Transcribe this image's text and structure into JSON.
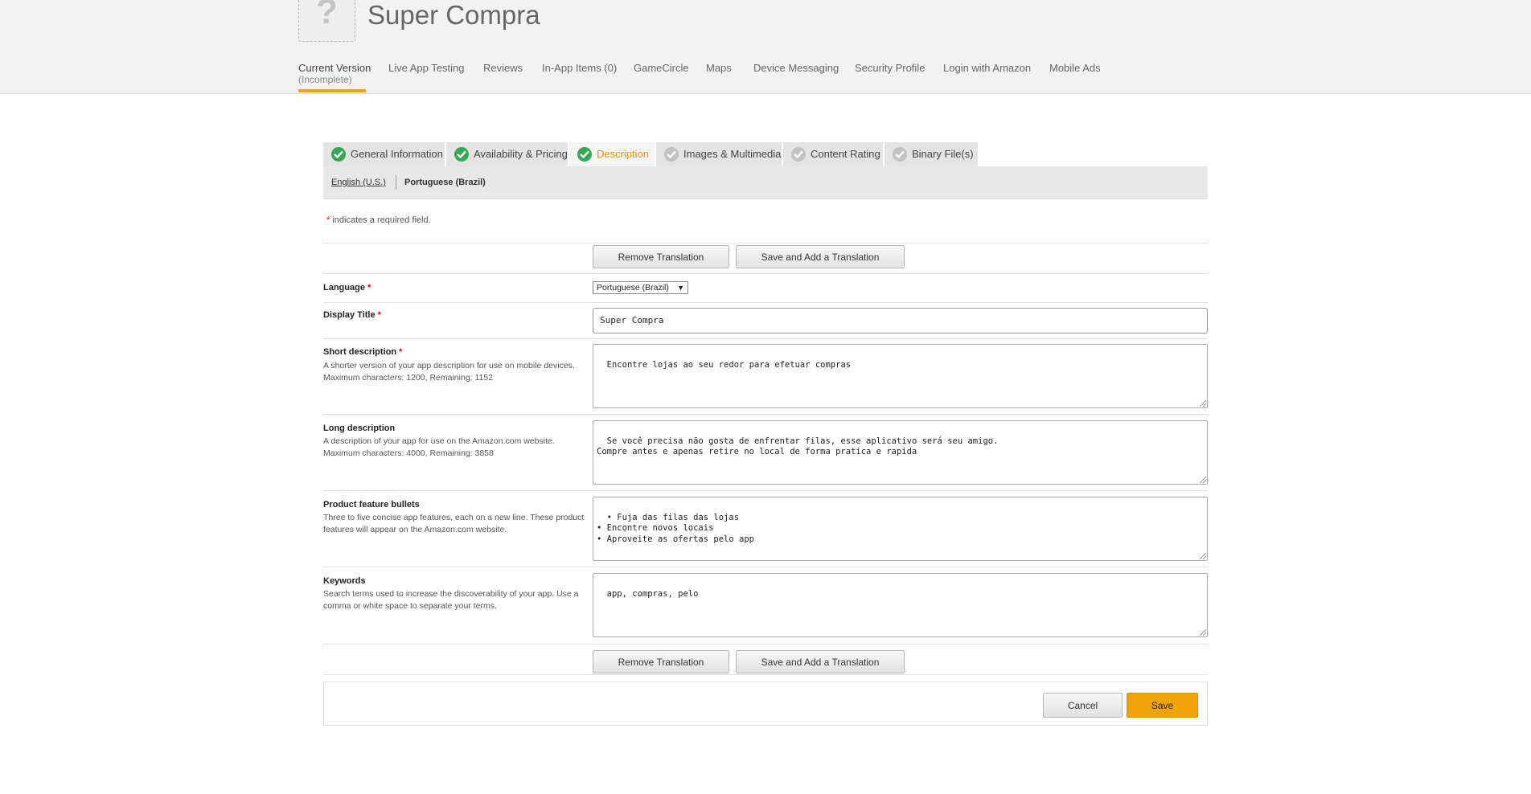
{
  "app": {
    "title": "Super Compra",
    "icon": "question-mark-placeholder-icon"
  },
  "main_tabs": [
    {
      "label": "Current Version",
      "sub": "(Incomplete)",
      "active": true
    },
    {
      "label": "Live App Testing"
    },
    {
      "label": "Reviews"
    },
    {
      "label": "In-App Items (0)"
    },
    {
      "label": "GameCircle"
    },
    {
      "label": "Maps"
    },
    {
      "label": "Device Messaging"
    },
    {
      "label": "Security Profile"
    },
    {
      "label": "Login with Amazon"
    },
    {
      "label": "Mobile Ads"
    }
  ],
  "section_tabs": [
    {
      "label": "General Information",
      "status": "complete"
    },
    {
      "label": "Availability & Pricing",
      "status": "complete"
    },
    {
      "label": "Description",
      "status": "complete",
      "active": true
    },
    {
      "label": "Images & Multimedia",
      "status": "incomplete"
    },
    {
      "label": "Content Rating",
      "status": "incomplete"
    },
    {
      "label": "Binary File(s)",
      "status": "incomplete"
    }
  ],
  "languages": {
    "english": "English (U.S.)",
    "portuguese": "Portuguese (Brazil)"
  },
  "required_note": {
    "star": "*",
    "text": " indicates a required field."
  },
  "buttons": {
    "remove_translation": "Remove Translation",
    "save_add_translation": "Save and Add a Translation",
    "cancel": "Cancel",
    "save": "Save"
  },
  "form": {
    "language": {
      "label": "Language",
      "value": "Portuguese (Brazil)"
    },
    "display_title": {
      "label": "Display Title",
      "value": "Super Compra"
    },
    "short_description": {
      "label": "Short description",
      "help1": "A shorter version of your app description for use on mobile devices.",
      "help2": "Maximum characters: 1200, Remaining: 1152",
      "value": "Encontre lojas ao seu redor para efetuar compras"
    },
    "long_description": {
      "label": "Long description",
      "help1": "A description of your app for use on the Amazon.com website.",
      "help2": "Maximum characters: 4000, Remaining: 3858",
      "value": "Se você precisa não gosta de enfrentar filas, esse aplicativo será seu amigo.\nCompre antes e apenas retire no local de forma pratica e rapida"
    },
    "feature_bullets": {
      "label": "Product feature bullets",
      "help1": "Three to five concise app features, each on a new line. These product features will appear on the Amazon.com website.",
      "value": "• Fuja das filas das lojas\n• Encontre novos locais\n• Aproveite as ofertas pelo app"
    },
    "keywords": {
      "label": "Keywords",
      "help1": "Search terms used to increase the discoverability of your app. Use a comma or white space to separate your terms.",
      "value": "app, compras, pelo"
    }
  },
  "colors": {
    "accent": "#f0a30a",
    "active_tab_text": "#e8930c",
    "check_green": "#34a853",
    "check_grey": "#c2c2c2",
    "required_star": "#dd0000"
  }
}
